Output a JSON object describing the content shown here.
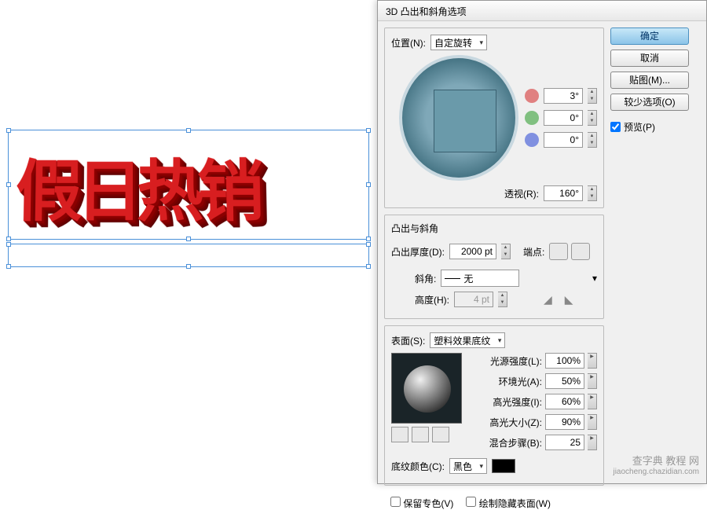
{
  "canvas": {
    "text3d": "假日热销"
  },
  "dialog": {
    "title": "3D 凸出和斜角选项",
    "buttons": {
      "ok": "确定",
      "cancel": "取消",
      "map": "贴图(M)...",
      "fewer": "较少选项(O)"
    },
    "preview": {
      "label": "预览(P)",
      "checked": true
    },
    "position": {
      "label": "位置(N):",
      "value": "自定旋转",
      "x": "3°",
      "y": "0°",
      "z": "0°",
      "perspective_label": "透视(R):",
      "perspective": "160°"
    },
    "extrude": {
      "group_label": "凸出与斜角",
      "depth_label": "凸出厚度(D):",
      "depth": "2000 pt",
      "cap_label": "端点:",
      "bevel_label": "斜角:",
      "bevel_value": "无",
      "height_label": "高度(H):",
      "height": "4 pt"
    },
    "surface": {
      "label": "表面(S):",
      "value": "塑料效果底纹",
      "light_intensity_label": "光源强度(L):",
      "light_intensity": "100%",
      "ambient_label": "环境光(A):",
      "ambient": "50%",
      "highlight_intensity_label": "高光强度(I):",
      "highlight_intensity": "60%",
      "highlight_size_label": "高光大小(Z):",
      "highlight_size": "90%",
      "blend_steps_label": "混合步骤(B):",
      "blend_steps": "25"
    },
    "shading": {
      "color_label": "底纹颜色(C):",
      "color_value": "黑色",
      "preserve_label": "保留专色(V)",
      "hidden_label": "绘制隐藏表面(W)"
    }
  },
  "watermark": {
    "line1": "查字典 教程 网",
    "line2": "jiaocheng.chazidian.com"
  }
}
